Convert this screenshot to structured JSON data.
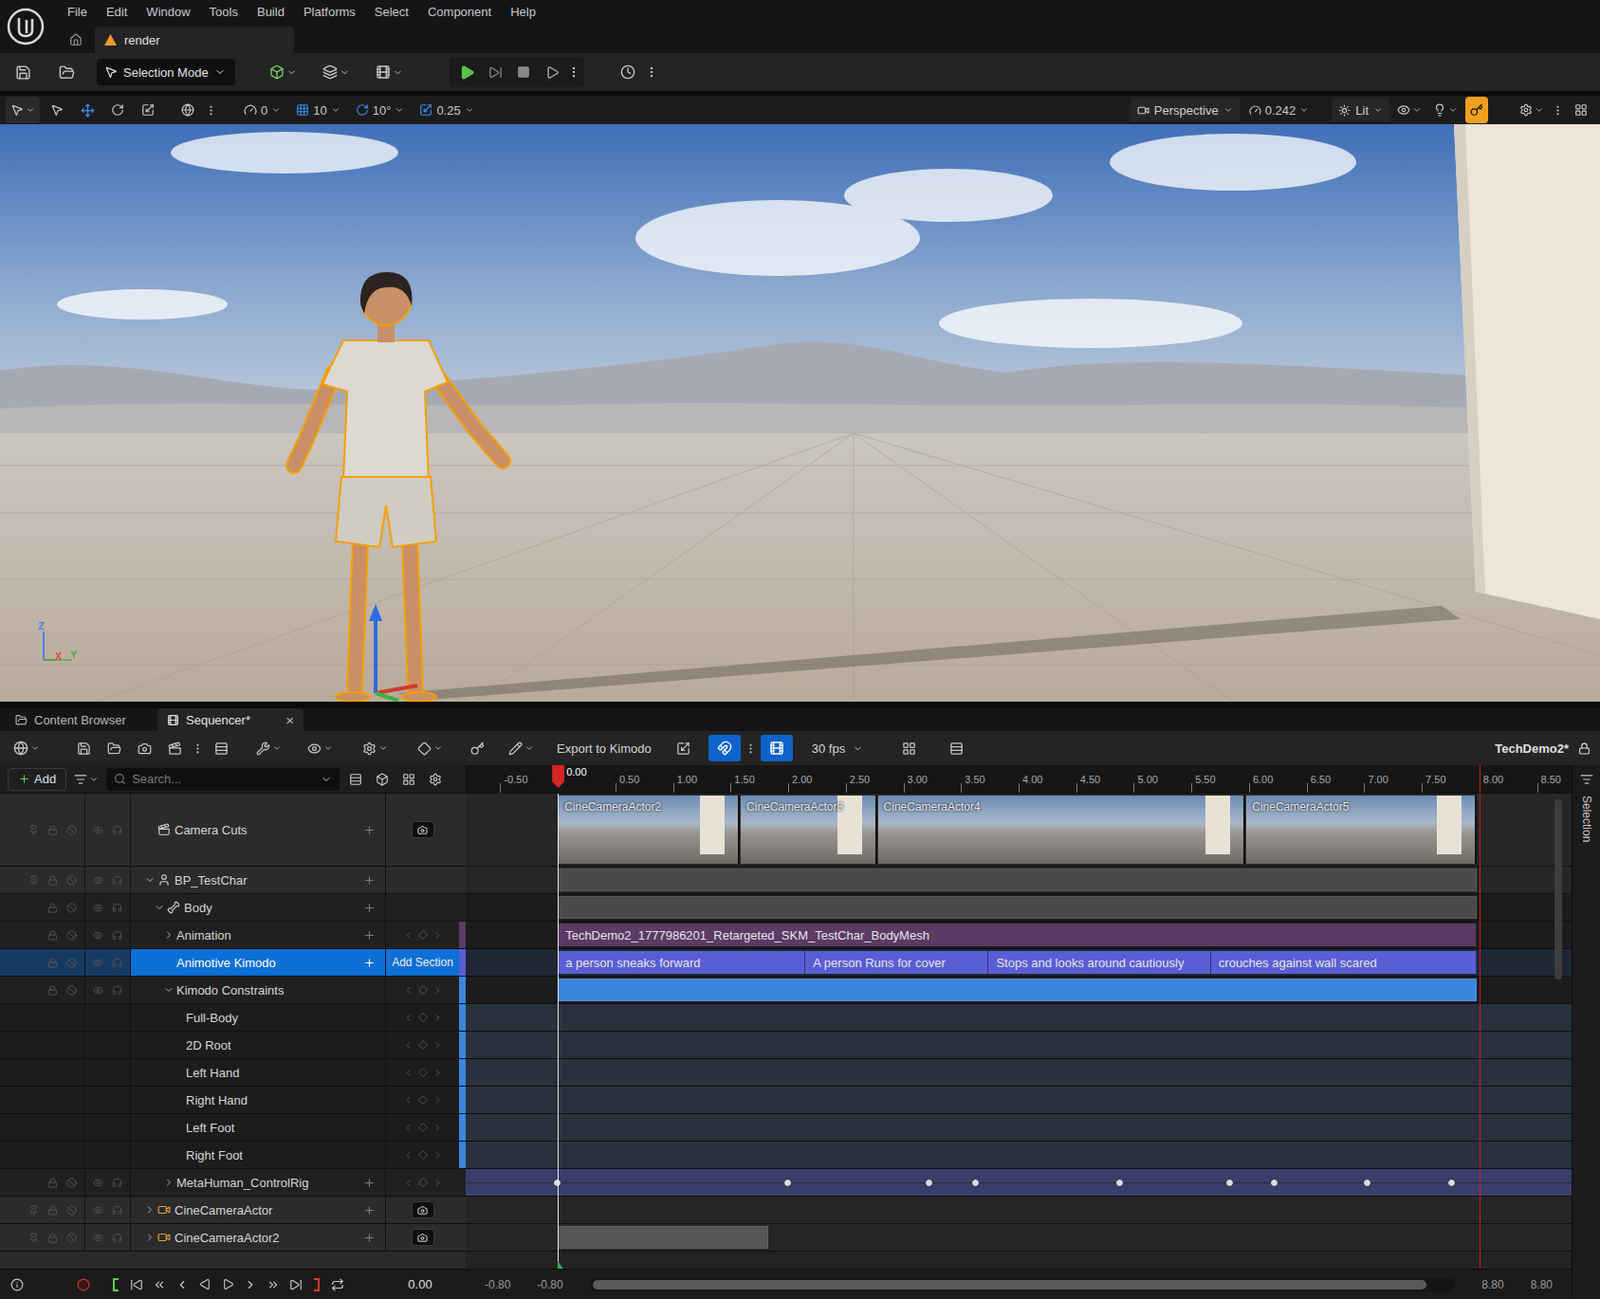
{
  "menu": [
    "File",
    "Edit",
    "Window",
    "Tools",
    "Build",
    "Platforms",
    "Select",
    "Component",
    "Help"
  ],
  "document_tab": {
    "label": "render"
  },
  "main_toolbar": {
    "mode": "Selection Mode"
  },
  "viewport_toolbar": {
    "snap_values": [
      "0",
      "10",
      "10°",
      "0.25"
    ],
    "view": "Perspective",
    "camera_speed": "0.242",
    "view_mode": "Lit",
    "warning_highlighted": true,
    "move_tool_selected": true
  },
  "viewport": {
    "axes": [
      "Z",
      "X",
      "Y"
    ]
  },
  "panel_tabs": [
    {
      "label": "Content Browser",
      "selected": false,
      "closable": false
    },
    {
      "label": "Sequencer*",
      "selected": true,
      "closable": true,
      "close": "×"
    }
  ],
  "sequencer_toolbar": {
    "export_label": "Export to Kimodo",
    "snap_on": true,
    "auto_scroll_on": true,
    "frame_rate": "30 fps",
    "sequence": "TechDemo2*"
  },
  "tree_toolbar": {
    "add_label": "Add",
    "search_placeholder": "Search..."
  },
  "side_panel": {
    "label": "Selection"
  },
  "ruler": {
    "labels": [
      "-0.50",
      "0.50",
      "1.00",
      "1.50",
      "2.00",
      "2.50",
      "3.00",
      "3.50",
      "4.00",
      "4.50",
      "5.00",
      "5.50",
      "6.00",
      "6.50",
      "7.00",
      "7.50",
      "8.00",
      "8.50"
    ],
    "playhead": "0.00"
  },
  "playback": {
    "start": 0,
    "end": 8
  },
  "tracks": [
    {
      "name": "Camera Cuts",
      "kind": "camera-cuts",
      "depth": 0,
      "expandable": false,
      "expanded": false,
      "selected": false,
      "add_button": true,
      "key_nav": false,
      "camera_toggle": true,
      "cuts": [
        {
          "label": "CineCameraActor2",
          "start": 0,
          "end": 1.58
        },
        {
          "label": "CineCameraActor3",
          "start": 1.58,
          "end": 2.77
        },
        {
          "label": "CineCameraActor4",
          "start": 2.77,
          "end": 5.97
        },
        {
          "label": "CineCameraActor5",
          "start": 5.97,
          "end": 7.98
        }
      ]
    },
    {
      "name": "BP_TestChar",
      "kind": "actor",
      "depth": 0,
      "expandable": true,
      "expanded": true,
      "selected": false,
      "add_button": true,
      "key_nav": false,
      "camera_toggle": false,
      "color": "#4a4a4a",
      "bar": {
        "start": 0,
        "end": 7.98
      }
    },
    {
      "name": "Body",
      "kind": "component",
      "depth": 1,
      "expandable": true,
      "expanded": true,
      "selected": false,
      "add_button": true,
      "key_nav": false,
      "camera_toggle": false,
      "color": "#4a4a4a",
      "bar": {
        "start": 0,
        "end": 7.98
      }
    },
    {
      "name": "Animation",
      "kind": "animation",
      "depth": 2,
      "expandable": true,
      "expanded": false,
      "selected": false,
      "add_button": true,
      "key_nav": true,
      "camera_toggle": false,
      "color": "#5b3a63",
      "sections": [
        {
          "label": "TechDemo2_1777986201_Retargeted_SKM_TestChar_BodyMesh",
          "start": 0,
          "end": 7.98
        }
      ]
    },
    {
      "name": "Animotive Kimodo",
      "kind": "kimodo",
      "depth": 2,
      "expandable": false,
      "expanded": false,
      "selected": true,
      "add_button": true,
      "key_nav": false,
      "camera_toggle": false,
      "action": "Add Section",
      "color": "#5a5ed4",
      "sections": [
        {
          "label": "a person sneaks forward",
          "start": 0,
          "end": 2.15
        },
        {
          "label": "A person Runs for cover",
          "start": 2.15,
          "end": 3.74
        },
        {
          "label": "Stops and looks around cautiously",
          "start": 3.74,
          "end": 5.67
        },
        {
          "label": "crouches against wall scared",
          "start": 5.67,
          "end": 7.98
        }
      ]
    },
    {
      "name": "Kimodo Constraints",
      "kind": "constraints",
      "depth": 2,
      "expandable": true,
      "expanded": true,
      "selected": false,
      "add_button": false,
      "key_nav": true,
      "camera_toggle": false,
      "color": "#3b86dc",
      "bar": {
        "start": 0,
        "end": 7.98
      }
    },
    {
      "name": "Full-Body",
      "kind": "channel",
      "depth": 3,
      "expandable": false,
      "expanded": false,
      "selected": false,
      "add_button": false,
      "key_nav": true,
      "camera_toggle": false,
      "color": "#3b86dc"
    },
    {
      "name": "2D Root",
      "kind": "channel",
      "depth": 3,
      "expandable": false,
      "expanded": false,
      "selected": false,
      "add_button": false,
      "key_nav": true,
      "camera_toggle": false,
      "color": "#3b86dc"
    },
    {
      "name": "Left Hand",
      "kind": "channel",
      "depth": 3,
      "expandable": false,
      "expanded": false,
      "selected": false,
      "add_button": false,
      "key_nav": true,
      "camera_toggle": false,
      "color": "#3b86dc"
    },
    {
      "name": "Right Hand",
      "kind": "channel",
      "depth": 3,
      "expandable": false,
      "expanded": false,
      "selected": false,
      "add_button": false,
      "key_nav": true,
      "camera_toggle": false,
      "color": "#3b86dc"
    },
    {
      "name": "Left Foot",
      "kind": "channel",
      "depth": 3,
      "expandable": false,
      "expanded": false,
      "selected": false,
      "add_button": false,
      "key_nav": true,
      "camera_toggle": false,
      "color": "#3b86dc"
    },
    {
      "name": "Right Foot",
      "kind": "channel",
      "depth": 3,
      "expandable": false,
      "expanded": false,
      "selected": false,
      "add_button": false,
      "key_nav": true,
      "camera_toggle": false,
      "color": "#3b86dc"
    },
    {
      "name": "MetaHuman_ControlRig",
      "kind": "control-rig",
      "depth": 2,
      "expandable": true,
      "expanded": false,
      "selected": false,
      "add_button": true,
      "key_nav": true,
      "camera_toggle": false,
      "color": "#3a3e6b",
      "keys": [
        0,
        2.0,
        3.23,
        3.63,
        4.88,
        5.84,
        6.22,
        7.03,
        7.76
      ]
    },
    {
      "name": "CineCameraActor",
      "kind": "camera",
      "depth": 0,
      "expandable": true,
      "expanded": false,
      "selected": false,
      "add_button": true,
      "key_nav": false,
      "camera_toggle": true
    },
    {
      "name": "CineCameraActor2",
      "kind": "camera",
      "depth": 0,
      "expandable": true,
      "expanded": false,
      "selected": false,
      "add_button": true,
      "key_nav": false,
      "camera_toggle": true,
      "color": "#555555",
      "bar": {
        "start": 0,
        "end": 1.83
      }
    }
  ],
  "transport": {
    "time": "0.00",
    "range_start": "-0.80",
    "view_start": "-0.80",
    "view_end": "8.80",
    "range_end": "8.80",
    "scroll_level": 0.97
  }
}
